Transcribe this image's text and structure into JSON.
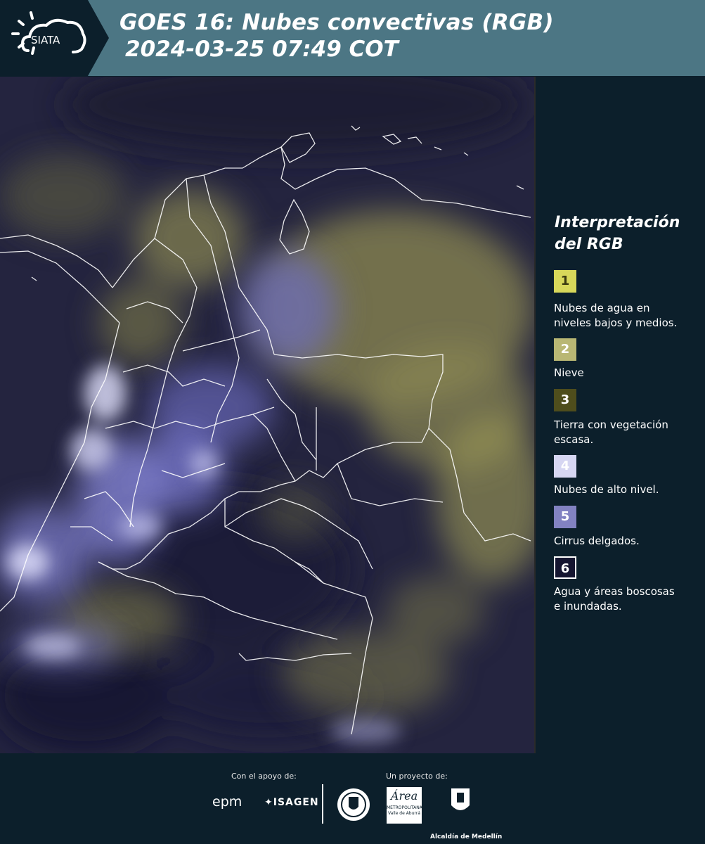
{
  "header": {
    "logo_text": "SIATA",
    "title_line1": "GOES 16: Nubes convectivas (RGB)",
    "title_line2": "2024-03-25 07:49 COT"
  },
  "legend": {
    "title_line1": "Interpretación",
    "title_line2": "del RGB",
    "items": [
      {
        "num": "1",
        "color": "#d8d85a",
        "text_color": "#3a3a10",
        "line1": "Nubes de agua en",
        "line2": "niveles bajos y medios."
      },
      {
        "num": "2",
        "color": "#b9b774",
        "text_color": "#ffffff",
        "line1": "Nieve",
        "line2": ""
      },
      {
        "num": "3",
        "color": "#4e4d1c",
        "text_color": "#ffffff",
        "line1": "Tierra con vegetación",
        "line2": "escasa."
      },
      {
        "num": "4",
        "color": "#d6d6f2",
        "text_color": "#ffffff",
        "line1": "Nubes de alto nivel.",
        "line2": ""
      },
      {
        "num": "5",
        "color": "#8282c2",
        "text_color": "#ffffff",
        "line1": "Cirrus delgados.",
        "line2": ""
      },
      {
        "num": "6",
        "color": "#151530",
        "text_color": "#ffffff",
        "line1": "Agua y áreas boscosas",
        "line2": "e inundadas."
      }
    ]
  },
  "footer": {
    "support_label": "Con el apoyo de:",
    "project_label": "Un proyecto de:",
    "epm": "epm",
    "isagen": "ISAGEN",
    "area_text": "Área",
    "area_sub1": "METROPOLITANA",
    "area_sub2": "Valle de Aburrá",
    "medellin": "Alcaldía de Medellín"
  },
  "map": {
    "description_icon": "goes16-satellite-image"
  }
}
